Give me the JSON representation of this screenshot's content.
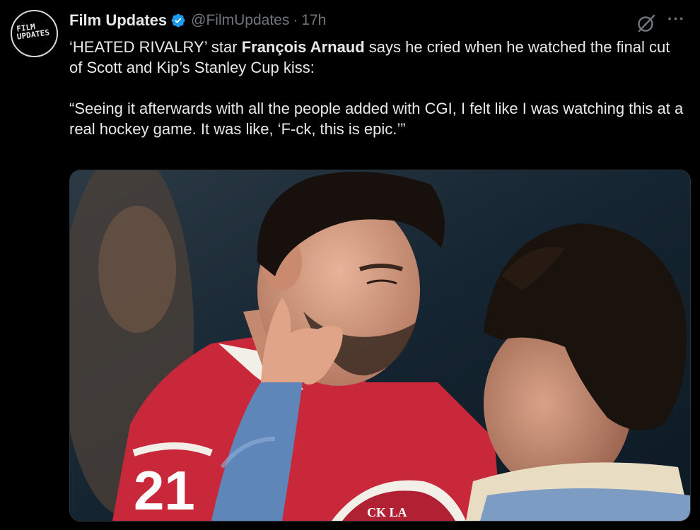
{
  "author": {
    "name": "Film Updates",
    "handle": "@FilmUpdates",
    "time": "17h",
    "dot": "·",
    "verified_icon": "verified-badge-icon",
    "avatar_logo_line1": "FILM",
    "avatar_logo_line2": "UPDATES"
  },
  "actions": {
    "grok_icon": "grok-icon",
    "more_label": "···"
  },
  "tweet": {
    "part1": "‘HEATED RIVALRY’ star ",
    "bold_name": "François Arnaud",
    "part2": " says he cried when he watched the final cut of Scott and Kip’s Stanley Cup kiss:",
    "quote": "“Seeing it afterwards with all the people added with CGI, I felt like I was watching this at a real hockey game. It was like, ‘F-ck, this is epic.’”"
  },
  "media": {
    "jersey_number": "21",
    "crest_text": "CK LA"
  },
  "colors": {
    "background": "#000000",
    "text": "#e7e9ea",
    "secondary": "#71767b",
    "verified": "#1d9bf0",
    "jersey_red": "#c8283a",
    "denim": "#5f86b8"
  }
}
